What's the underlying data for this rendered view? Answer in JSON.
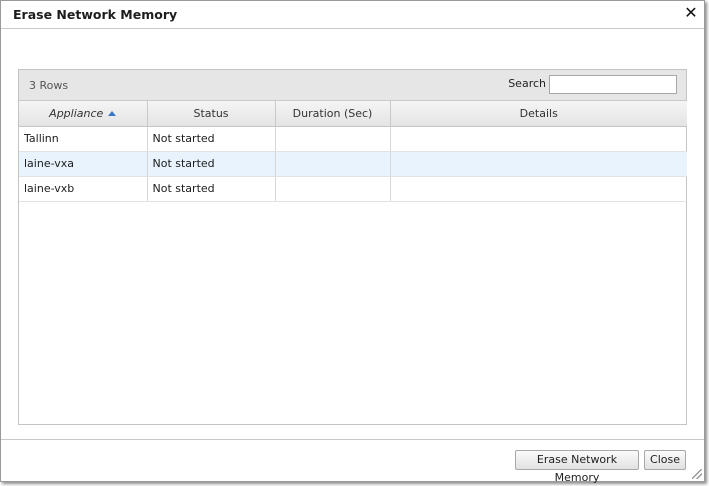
{
  "dialog": {
    "title": "Erase Network Memory",
    "close_icon": "close-icon"
  },
  "grid": {
    "row_count": "3 Rows",
    "search_label": "Search",
    "search_value": "",
    "columns": [
      {
        "label": "Appliance",
        "sorted": "ascending"
      },
      {
        "label": "Status"
      },
      {
        "label": "Duration (Sec)"
      },
      {
        "label": "Details"
      }
    ],
    "rows": [
      {
        "appliance": "Tallinn",
        "status": "Not started",
        "duration": "",
        "details": ""
      },
      {
        "appliance": "laine-vxa",
        "status": "Not started",
        "duration": "",
        "details": ""
      },
      {
        "appliance": "laine-vxb",
        "status": "Not started",
        "duration": "",
        "details": ""
      }
    ]
  },
  "buttons": {
    "erase_label": "Erase Network Memory",
    "close_label": "Close"
  },
  "colors": {
    "alt_row": "#e8f3fd",
    "sort_arrow": "#3a78c8"
  }
}
